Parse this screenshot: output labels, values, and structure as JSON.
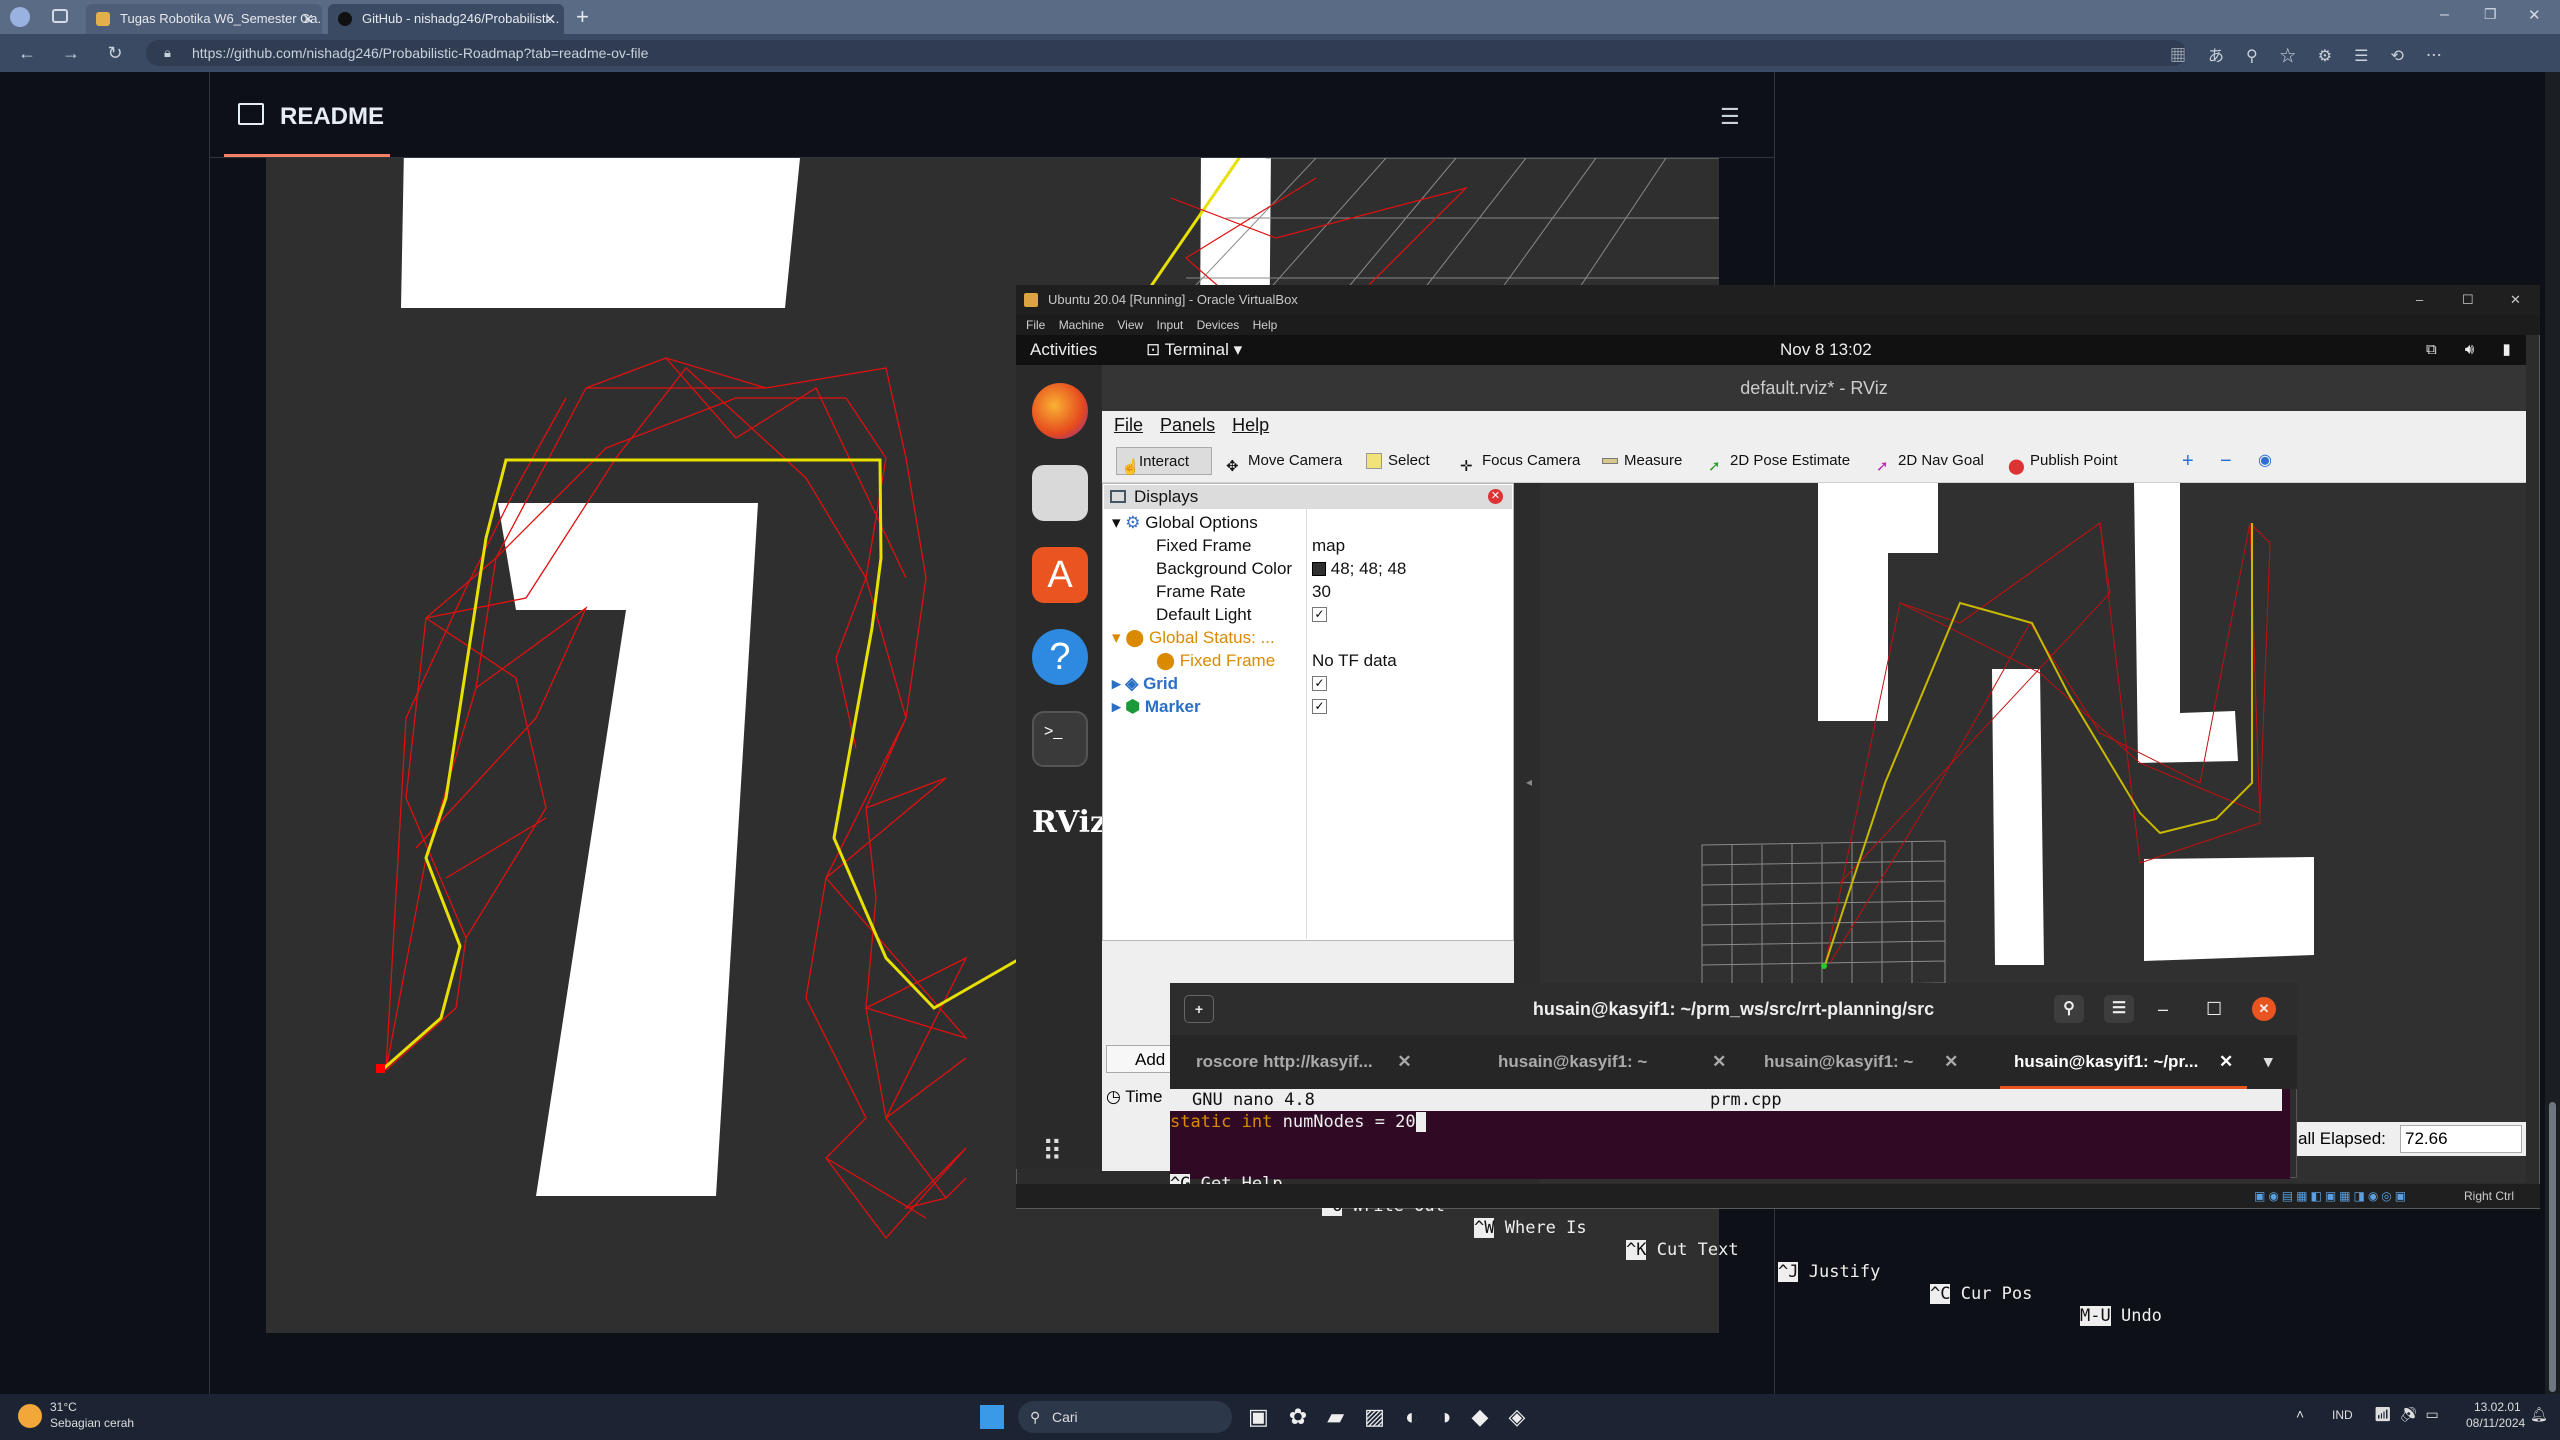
{
  "browser": {
    "tabs": [
      {
        "label": "Tugas Robotika W6_Semester Ga...",
        "active": false
      },
      {
        "label": "GitHub - nishadg246/Probabilisti...",
        "active": true
      }
    ],
    "url": "https://github.com/nishadg246/Probabilistic-Roadmap?tab=readme-ov-file"
  },
  "github": {
    "readme_title": "README"
  },
  "vbox": {
    "title": "Ubuntu 20.04 [Running] - Oracle VirtualBox",
    "menu": [
      "File",
      "Machine",
      "View",
      "Input",
      "Devices",
      "Help"
    ],
    "status_right": "Right Ctrl"
  },
  "ubuntu": {
    "activities": "Activities",
    "app": "Terminal",
    "clock": "Nov 8  13:02"
  },
  "rviz": {
    "title": "default.rviz* - RViz",
    "menu": [
      "File",
      "Panels",
      "Help"
    ],
    "tools": [
      "Interact",
      "Move Camera",
      "Select",
      "Focus Camera",
      "Measure",
      "2D Pose Estimate",
      "2D Nav Goal",
      "Publish Point"
    ],
    "displays_title": "Displays",
    "tree": {
      "global_options": "Global Options",
      "fixed_frame_label": "Fixed Frame",
      "fixed_frame_value": "map",
      "bg_label": "Background Color",
      "bg_value": "48; 48; 48",
      "rate_label": "Frame Rate",
      "rate_value": "30",
      "light_label": "Default Light",
      "status_label": "Global Status: ...",
      "status_fixed_label": "Fixed Frame",
      "status_fixed_value": "No TF data",
      "grid_label": "Grid",
      "marker_label": "Marker"
    },
    "add_label": "Add",
    "time_label": "Time",
    "elapsed_label": "all Elapsed:",
    "elapsed_value": "72.66"
  },
  "terminal": {
    "title": "husain@kasyif1: ~/prm_ws/src/rrt-planning/src",
    "tabs": [
      "roscore http://kasyif...",
      "husain@kasyif1: ~",
      "husain@kasyif1: ~",
      "husain@kasyif1: ~/pr..."
    ],
    "nano_header_left": "GNU nano 4.8",
    "nano_header_file": "prm.cpp",
    "code_line_keyword": "static int",
    "code_line_rest": " numNodes = 20",
    "shortcuts": [
      {
        "key": "^G",
        "label": "Get Help"
      },
      {
        "key": "^O",
        "label": "Write Out"
      },
      {
        "key": "^W",
        "label": "Where Is"
      },
      {
        "key": "^K",
        "label": "Cut Text"
      },
      {
        "key": "^J",
        "label": "Justify"
      },
      {
        "key": "^C",
        "label": "Cur Pos"
      },
      {
        "key": "M-U",
        "label": "Undo"
      }
    ]
  },
  "taskbar": {
    "weather_temp": "31°C",
    "weather_desc": "Sebagian cerah",
    "search": "Cari",
    "lang": "IND",
    "time": "13.02.01",
    "date": "08/11/2024"
  },
  "colors": {
    "path_yellow": "#e8e000",
    "edge_red": "#e01010",
    "accent_orange": "#f78166"
  }
}
